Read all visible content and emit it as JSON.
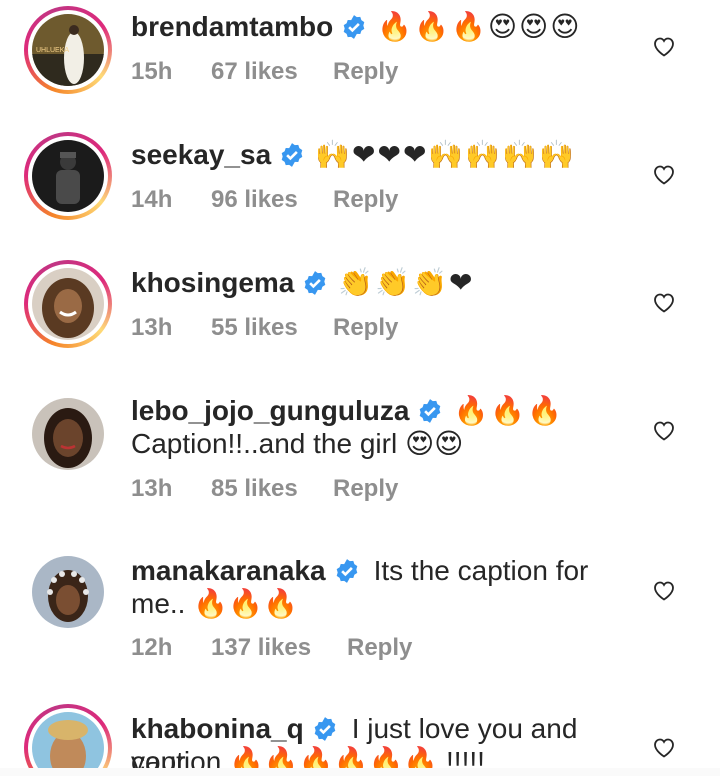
{
  "comments": [
    {
      "username": "brendamtambo",
      "text": "",
      "emoji": "🔥🔥🔥😍😍😍",
      "time": "15h",
      "likes": "67 likes",
      "reply": "Reply",
      "avatar_text": "UHLUEKA"
    },
    {
      "username": "seekay_sa",
      "text": "",
      "emoji": "🙌❤❤❤🙌🙌🙌🙌",
      "time": "14h",
      "likes": "96 likes",
      "reply": "Reply"
    },
    {
      "username": "khosingema",
      "text": "",
      "emoji": "👏👏👏❤",
      "time": "13h",
      "likes": "55 likes",
      "reply": "Reply"
    },
    {
      "username": "lebo_jojo_gunguluza",
      "emoji": "🔥🔥🔥",
      "line2": "Caption!!..and the girl 😍😍",
      "time": "13h",
      "likes": "85 likes",
      "reply": "Reply"
    },
    {
      "username": "manakaranaka",
      "text": "Its the caption for",
      "line2": "me.. 🔥🔥🔥",
      "time": "12h",
      "likes": "137 likes",
      "reply": "Reply"
    },
    {
      "username": "khabonina_q",
      "text": "I just love you and your",
      "line2": "caption 🔥🔥🔥🔥🔥🔥 !!!!!"
    }
  ],
  "colors": {
    "text": "#262626",
    "meta": "#8e8e8e",
    "verified": "#3897f0"
  },
  "icons": {
    "verified": "verified-badge-icon",
    "like": "heart-outline-icon"
  }
}
